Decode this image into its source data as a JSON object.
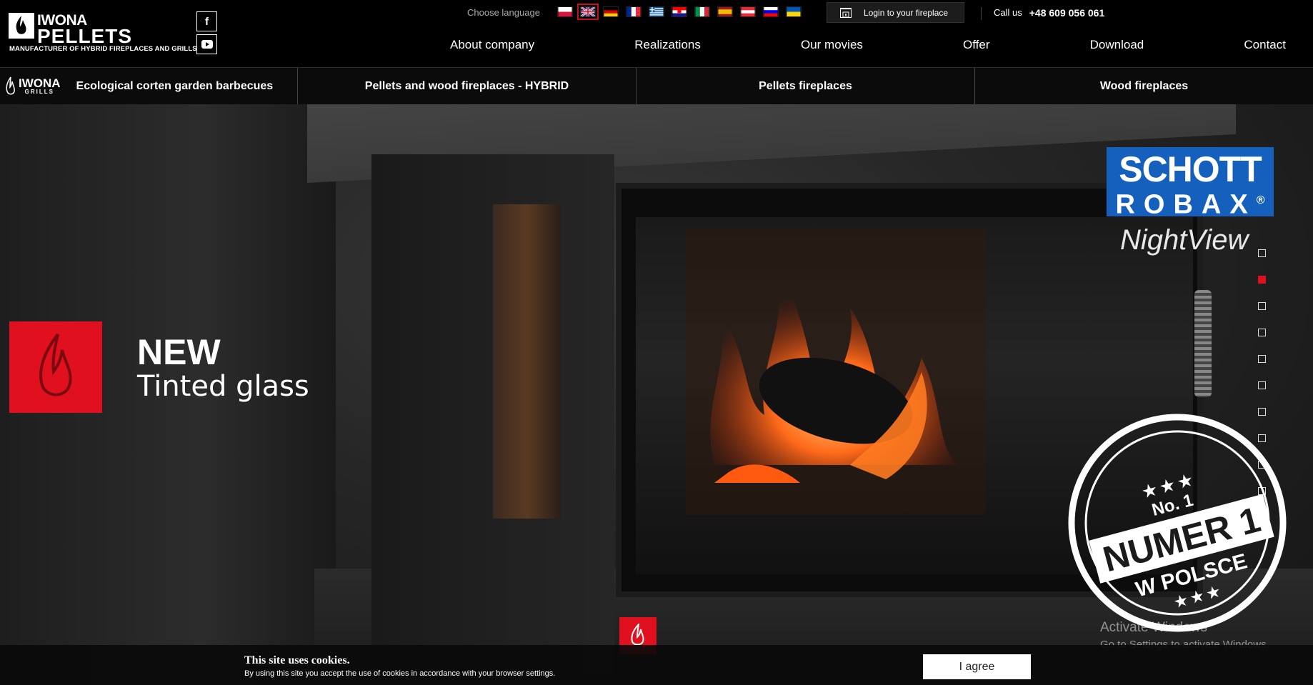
{
  "brand": {
    "logo_top": "IWONA",
    "logo_bottom": "PELLETS",
    "tagline": "MANUFACTURER OF HYBRID FIREPLACES AND GRILLS"
  },
  "social": {
    "facebook": "f",
    "youtube": "▶"
  },
  "language": {
    "label": "Choose language",
    "flags": [
      "pl",
      "en",
      "de",
      "fr",
      "gr",
      "hr",
      "it",
      "es",
      "at",
      "si",
      "ua"
    ],
    "active": "en"
  },
  "login": {
    "label": "Login to your fireplace"
  },
  "call": {
    "label": "Call us",
    "phone": "+48 609 056 061"
  },
  "nav": {
    "items": [
      "About company",
      "Realizations",
      "Our movies",
      "Offer",
      "Download",
      "Contact"
    ]
  },
  "categories": {
    "grills_logo_top": "IWONA",
    "grills_logo_bottom": "GRILLS",
    "items": [
      "Ecological corten garden barbecues",
      "Pellets and wood fireplaces - HYBRID",
      "Pellets fireplaces",
      "Wood fireplaces"
    ]
  },
  "hero": {
    "title": "NEW",
    "subtitle": "Tinted glass",
    "schott_1": "SCHOTT",
    "schott_2": "ROBAX",
    "schott_reg": "®",
    "nightview": "NightView",
    "slide_count": 11,
    "active_slide": 2,
    "stamp_no": "No. 1",
    "stamp_main": "NUMER 1",
    "stamp_sub": "W POLSCE"
  },
  "watermark": {
    "line1": "Activate Windows",
    "line2": "Go to Settings to activate Windows."
  },
  "cookie": {
    "title": "This site uses cookies.",
    "text": "By using this site you accept the use of cookies in accordance with your browser settings.",
    "button": "I agree"
  },
  "colors": {
    "accent": "#e0101e",
    "schott_blue": "#1560bd",
    "background": "#000000"
  }
}
